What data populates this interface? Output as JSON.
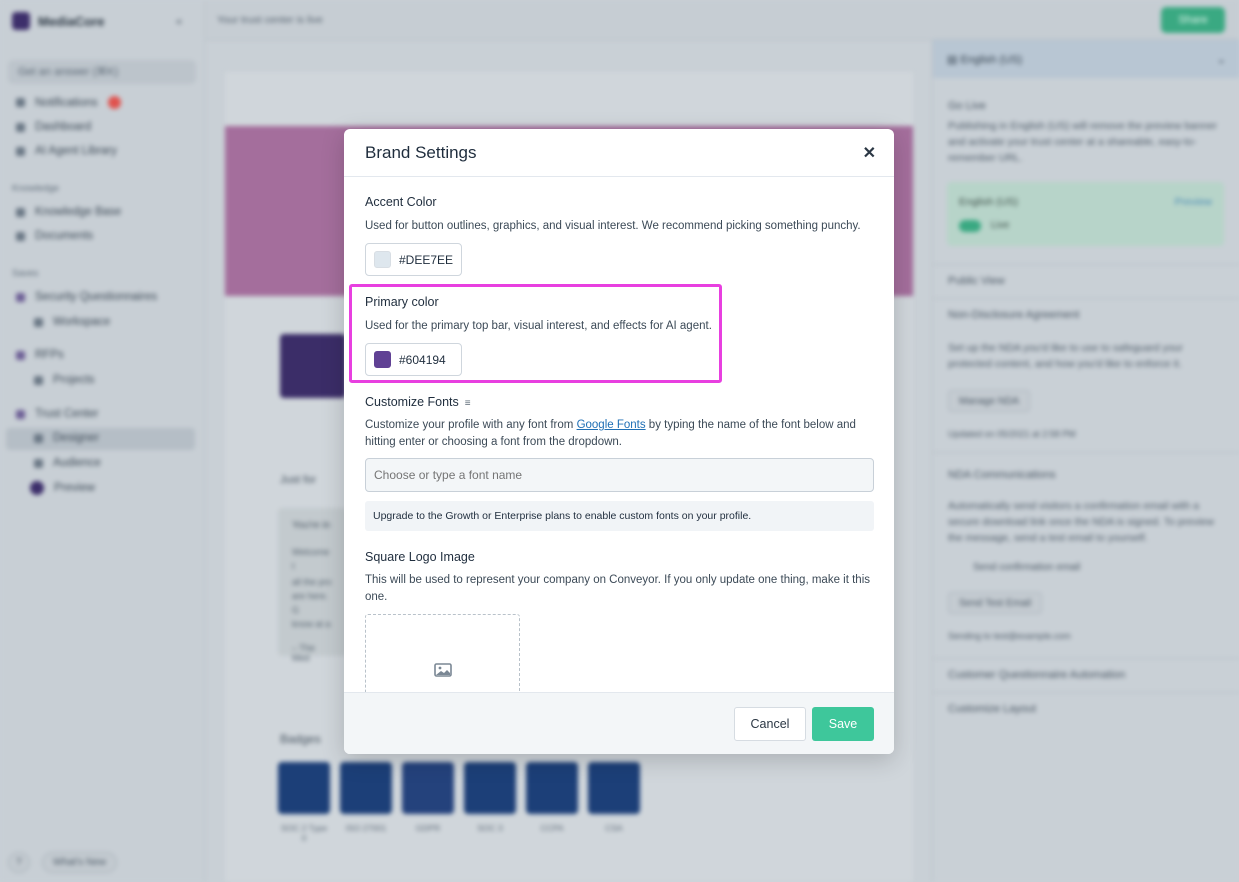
{
  "app": {
    "brand": "MediaCore",
    "search_label": "Get an answer  (⌘K)",
    "notifications": "Notifications",
    "dashboard": "Dashboard",
    "ai_agent_library": "AI Agent Library",
    "knowledge_heading": "Knowledge",
    "knowledge_base": "Knowledge Base",
    "documents": "Documents",
    "saved_heading": "Saves",
    "security_questionnaires": "Security Questionnaires",
    "workspace": "Workspace",
    "rfps": "RFPs",
    "projects": "Projects",
    "trust_center": "Trust Center",
    "designer": "Designer",
    "audience": "Audience",
    "preview": "Preview",
    "whats_new": "What's New",
    "help": "?"
  },
  "topbar": {
    "notice": "Your trust center is live",
    "share_label": "Share"
  },
  "center": {
    "just_for": "Just for",
    "welcome_title": "You're in",
    "welcome_lines": [
      "Welcome t",
      "all the pro",
      "are here. G",
      "know at a"
    ],
    "welcome_sign": "– The Med",
    "badges_label": "Badges",
    "badges": [
      {
        "caption": "SOC 2 Type II"
      },
      {
        "caption": "ISO 27001"
      },
      {
        "caption": "GDPR"
      },
      {
        "caption": "SOC 3"
      },
      {
        "caption": "CCPA"
      },
      {
        "caption": "CSA"
      }
    ]
  },
  "right_panel": {
    "language": "English (US)",
    "go_live_title": "Go Live",
    "go_live_desc": "Publishing in English (US) will remove the preview banner and activate your trust center at a shareable, easy-to-remember URL.",
    "status_lang": "English (US)",
    "preview_link": "Preview",
    "live_label": "Live",
    "public_view": "Public View",
    "nda": "Non-Disclosure Agreement",
    "nda_desc": "Set up the NDA you'd like to use to safeguard your protected content, and how you'd like to enforce it.",
    "manage_nda": "Manage NDA",
    "updated": "Updated on 05/2021 at 2:58 PM",
    "nda_comms": "NDA Communications",
    "nda_comms_desc": "Automatically send visitors a confirmation email with a secure download link once the NDA is signed. To preview the message, send a test email to yourself.",
    "send_confirmation": "Send confirmation email",
    "send_test": "Send Test Email",
    "sending_to": "Sending to test@example.com",
    "cq_automation": "Customer Questionnaire Automation",
    "customize_layout": "Customize Layout"
  },
  "modal": {
    "title": "Brand Settings",
    "accent": {
      "label": "Accent Color",
      "desc": "Used for button outlines, graphics, and visual interest. We recommend picking something punchy.",
      "value": "#DEE7EE",
      "swatch": "#DEE7EE"
    },
    "primary": {
      "label": "Primary color",
      "desc": "Used for the primary top bar, visual interest, and effects for AI agent.",
      "value": "#604194",
      "swatch": "#604194"
    },
    "fonts": {
      "label": "Customize Fonts",
      "desc_before": "Customize your profile with any font from ",
      "desc_link": "Google Fonts",
      "desc_after": " by typing the name of the font below and hitting enter or choosing a font from the dropdown.",
      "placeholder": "Choose or type a font name",
      "upgrade_note": "Upgrade to the Growth or Enterprise plans to enable custom fonts on your profile."
    },
    "logo": {
      "label": "Square Logo Image",
      "desc": "This will be used to represent your company on Conveyor. If you only update one thing, make it this one."
    },
    "cancel_label": "Cancel",
    "save_label": "Save"
  },
  "colors": {
    "save": "#3EC79B",
    "highlight": "#E83FE0"
  }
}
